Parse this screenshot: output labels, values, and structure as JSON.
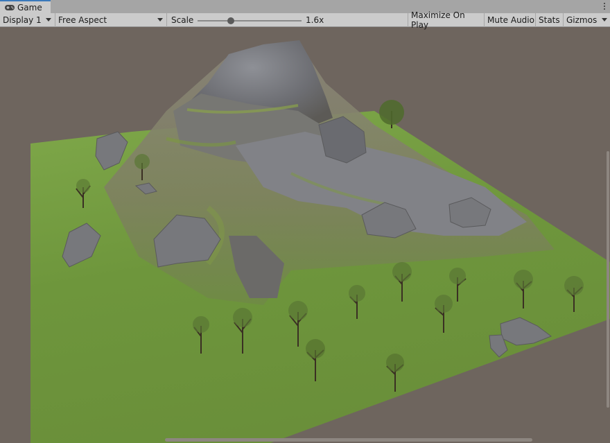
{
  "tab": {
    "title": "Game",
    "icon": "gamepad-icon",
    "menu_icon": "kebab-menu-icon"
  },
  "toolbar": {
    "display": "Display 1",
    "aspect": "Free Aspect",
    "scale_label": "Scale",
    "scale_value": "1.6x",
    "scale_slider_fraction": 0.32,
    "maximize_on_play": "Maximize On Play",
    "mute_audio": "Mute Audio",
    "stats": "Stats",
    "gizmos": "Gizmos"
  },
  "scene": {
    "sky_color": "#6e655e",
    "grass_color": "#6f9a3a",
    "rock_color": "#7a7b80"
  }
}
